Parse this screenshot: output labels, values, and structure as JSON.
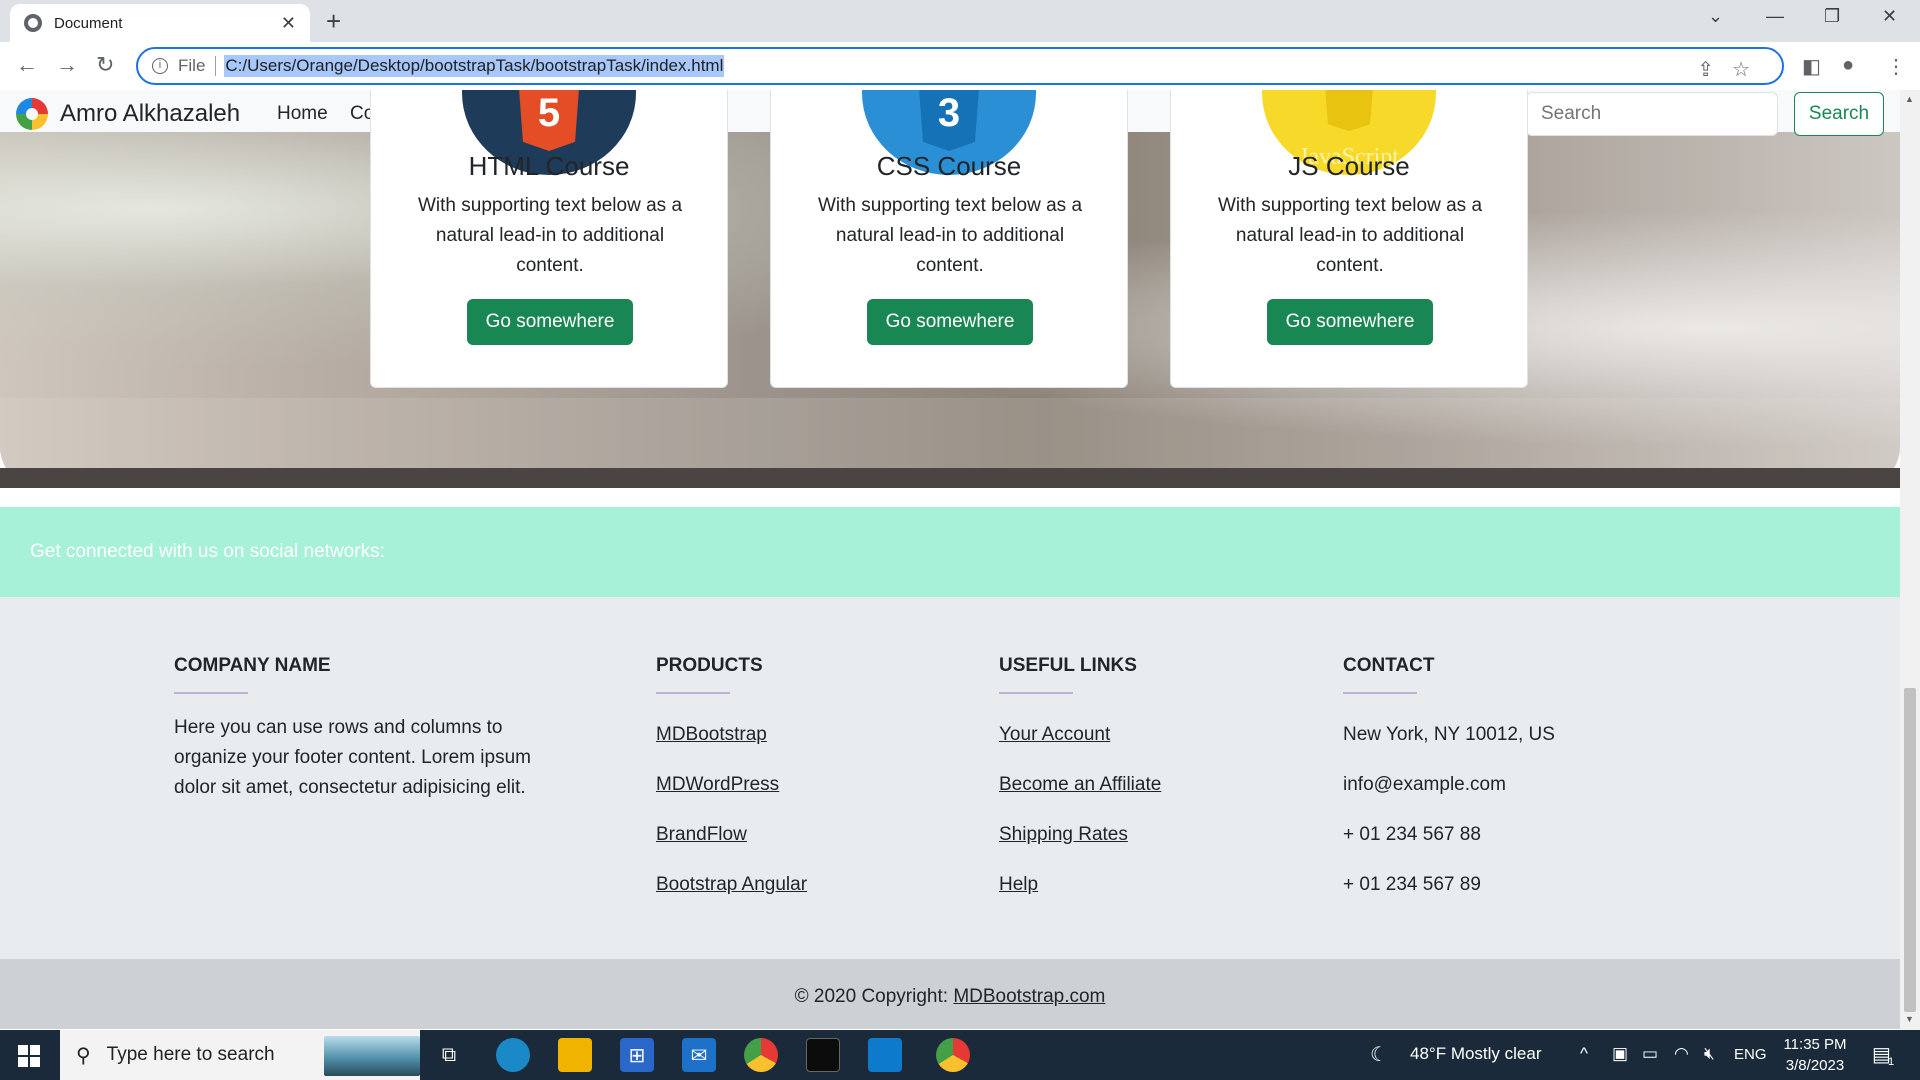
{
  "browser": {
    "tab_title": "Document",
    "new_tab_icon": "plus",
    "scheme_label": "File",
    "url": "C:/Users/Orange/Desktop/bootstrapTask/bootstrapTask/index.html"
  },
  "navbar": {
    "brand": "Amro Alkhazaleh",
    "links": [
      "Home",
      "Co"
    ],
    "search_placeholder": "Search",
    "search_button": "Search"
  },
  "cards": [
    {
      "title": "HTML Course",
      "text": "With supporting text below as a natural lead-in to additional content.",
      "button": "Go somewhere",
      "badge_color": "#e44d26",
      "circle_color": "#1f3b5a"
    },
    {
      "title": "CSS Course",
      "text": "With supporting text below as a natural lead-in to additional content.",
      "button": "Go somewhere",
      "badge_color": "#1572b6",
      "circle_color": "#2b8fd6"
    },
    {
      "title": "JS Course",
      "text": "With supporting text below as a natural lead-in to additional content.",
      "button": "Go somewhere",
      "badge_color": "#e8c30f",
      "circle_color": "#f7d92a",
      "logo_text": "JavaScript"
    }
  ],
  "social": {
    "text": "Get connected with us on social networks:"
  },
  "footer": {
    "company": {
      "heading": "COMPANY NAME",
      "body": "Here you can use rows and columns to organize your footer content. Lorem ipsum dolor sit amet, consectetur adipisicing elit."
    },
    "products": {
      "heading": "PRODUCTS",
      "links": [
        "MDBootstrap",
        "MDWordPress",
        "BrandFlow",
        "Bootstrap Angular"
      ]
    },
    "useful": {
      "heading": "USEFUL LINKS",
      "links": [
        "Your Account",
        "Become an Affiliate",
        "Shipping Rates",
        "Help"
      ]
    },
    "contact": {
      "heading": "CONTACT",
      "items": [
        "New York, NY 10012, US",
        "info@example.com",
        "+ 01 234 567 88",
        "+ 01 234 567 89"
      ]
    },
    "copyright_prefix": "© 2020 Copyright: ",
    "copyright_link": "MDBootstrap.com"
  },
  "taskbar": {
    "search_placeholder": "Type here to search",
    "weather": "48°F  Mostly clear",
    "language": "ENG",
    "time": "11:35 PM",
    "date": "3/8/2023",
    "notification_count": "1"
  },
  "colors": {
    "accent": "#198754",
    "social_band": "#a7f1d8",
    "footer_bg": "#e9ecef"
  }
}
